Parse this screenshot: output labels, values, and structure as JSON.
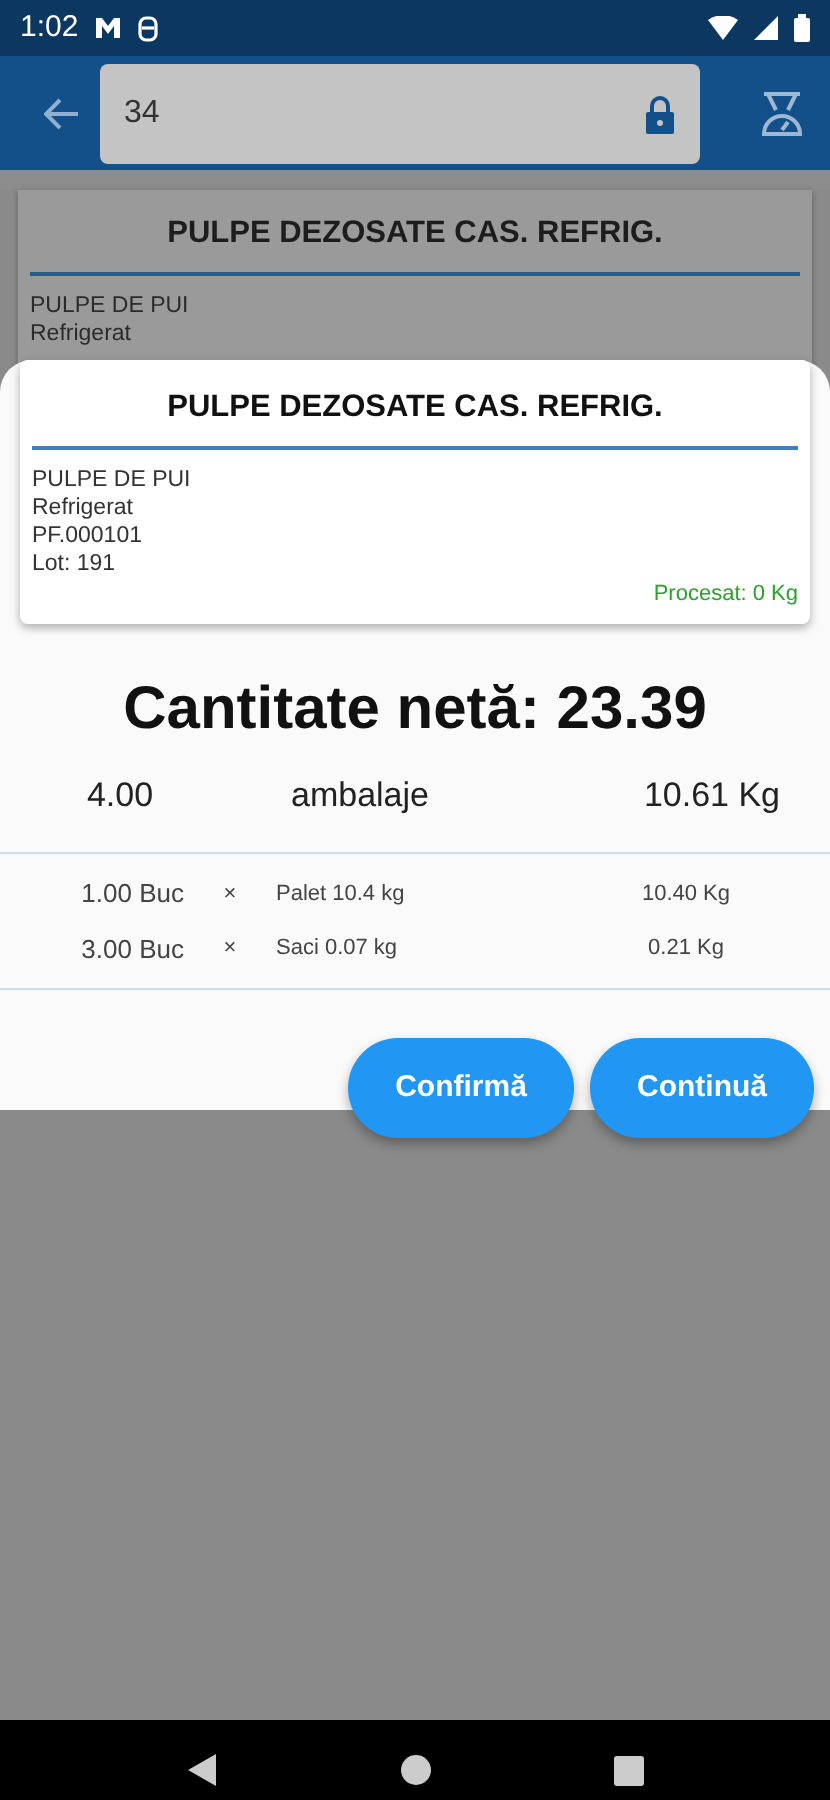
{
  "status_bar": {
    "time": "1:02"
  },
  "app_bar": {
    "search_value": "34"
  },
  "background_card": {
    "title": "PULPE DEZOSATE CAS. REFRIG.",
    "lines": [
      "PULPE DE PUI",
      "Refrigerat"
    ]
  },
  "sheet": {
    "card": {
      "title": "PULPE DEZOSATE CAS. REFRIG.",
      "lines": [
        "PULPE DE PUI",
        "Refrigerat",
        "PF.000101",
        "Lot: 191"
      ],
      "processed": "Procesat: 0 Kg"
    },
    "net_quantity": "Cantitate netă: 23.39",
    "summary": {
      "count": "4.00",
      "label": "ambalaje",
      "weight": "10.61 Kg"
    },
    "packages": [
      {
        "quantity": "1.00 Buc",
        "sign": "×",
        "name": "Palet 10.4 kg",
        "weight": "10.40 Kg"
      },
      {
        "quantity": "3.00 Buc",
        "sign": "×",
        "name": "Saci 0.07 kg",
        "weight": "0.21 Kg"
      }
    ],
    "buttons": [
      "Confirmă",
      "Continuă"
    ]
  }
}
